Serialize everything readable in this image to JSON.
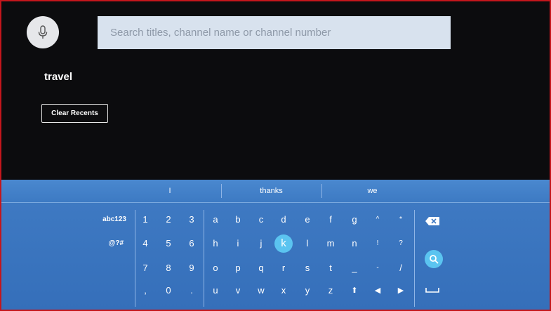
{
  "search": {
    "placeholder": "Search titles, channel name or channel number"
  },
  "recents": {
    "items": [
      "travel"
    ],
    "clear_label": "Clear Recents"
  },
  "suggestions": [
    "I",
    "thanks",
    "we"
  ],
  "keyboard": {
    "modes": [
      "abc123",
      "@?#"
    ],
    "rows": [
      [
        "1",
        "2",
        "3",
        "a",
        "b",
        "c",
        "d",
        "e",
        "f",
        "g",
        "^",
        "*"
      ],
      [
        "4",
        "5",
        "6",
        "h",
        "i",
        "j",
        "k",
        "l",
        "m",
        "n",
        "!",
        "?"
      ],
      [
        "7",
        "8",
        "9",
        "o",
        "p",
        "q",
        "r",
        "s",
        "t",
        "_",
        "-",
        "/"
      ],
      [
        ",",
        "0",
        ".",
        "u",
        "v",
        "w",
        "x",
        "y",
        "z",
        "⬆",
        "◀",
        "▶"
      ]
    ],
    "selected_key": "k",
    "icons": {
      "backspace": "backspace-icon",
      "search": "search-icon",
      "space": "space-icon",
      "mic": "microphone-icon"
    },
    "accent_color": "#5bc4f0",
    "background_color": "#3e79c2"
  }
}
